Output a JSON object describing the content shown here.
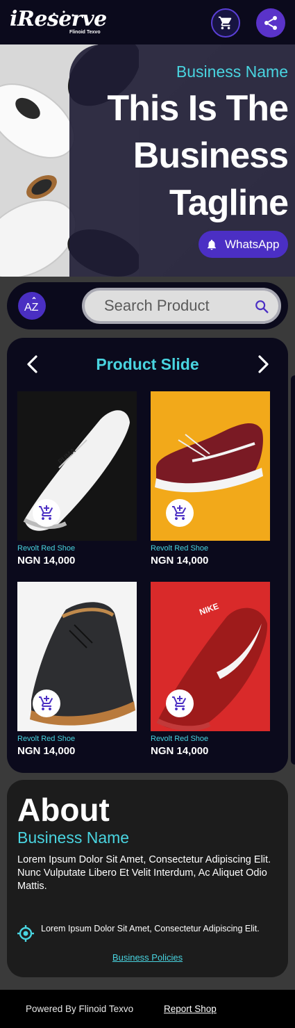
{
  "header": {
    "logo_text": "iReserve",
    "logo_sub": "Flinoid Texvo"
  },
  "hero": {
    "business_name": "Business Name",
    "tagline": "This Is The Business Tagline",
    "whatsapp_label": "WhatsApp"
  },
  "search": {
    "sort_label": "AZ",
    "placeholder": "Search Product"
  },
  "slide": {
    "title": "Product Slide",
    "products": [
      {
        "name": "Revolt Red Shoe",
        "price": "NGN 14,000"
      },
      {
        "name": "Revolt Red Shoe",
        "price": "NGN 14,000"
      },
      {
        "name": "Revolt Red Shoe",
        "price": "NGN 14,000"
      },
      {
        "name": "Revolt Red Shoe",
        "price": "NGN 14,000"
      }
    ]
  },
  "about": {
    "title": "About",
    "business_name": "Business Name",
    "description": "Lorem Ipsum Dolor Sit Amet, Consectetur Adipiscing Elit. Nunc Vulputate Libero Et Velit Interdum, Ac Aliquet Odio Mattis.",
    "address": "Lorem Ipsum Dolor Sit Amet, Consectetur Adipiscing Elit.",
    "policies_label": "Business Policies"
  },
  "footer": {
    "powered_by": "Powered By Flinoid Texvo",
    "report_label": "Report Shop"
  },
  "colors": {
    "accent": "#49d4e0",
    "brand": "#4b2fc4",
    "dark": "#0b0a1c"
  }
}
